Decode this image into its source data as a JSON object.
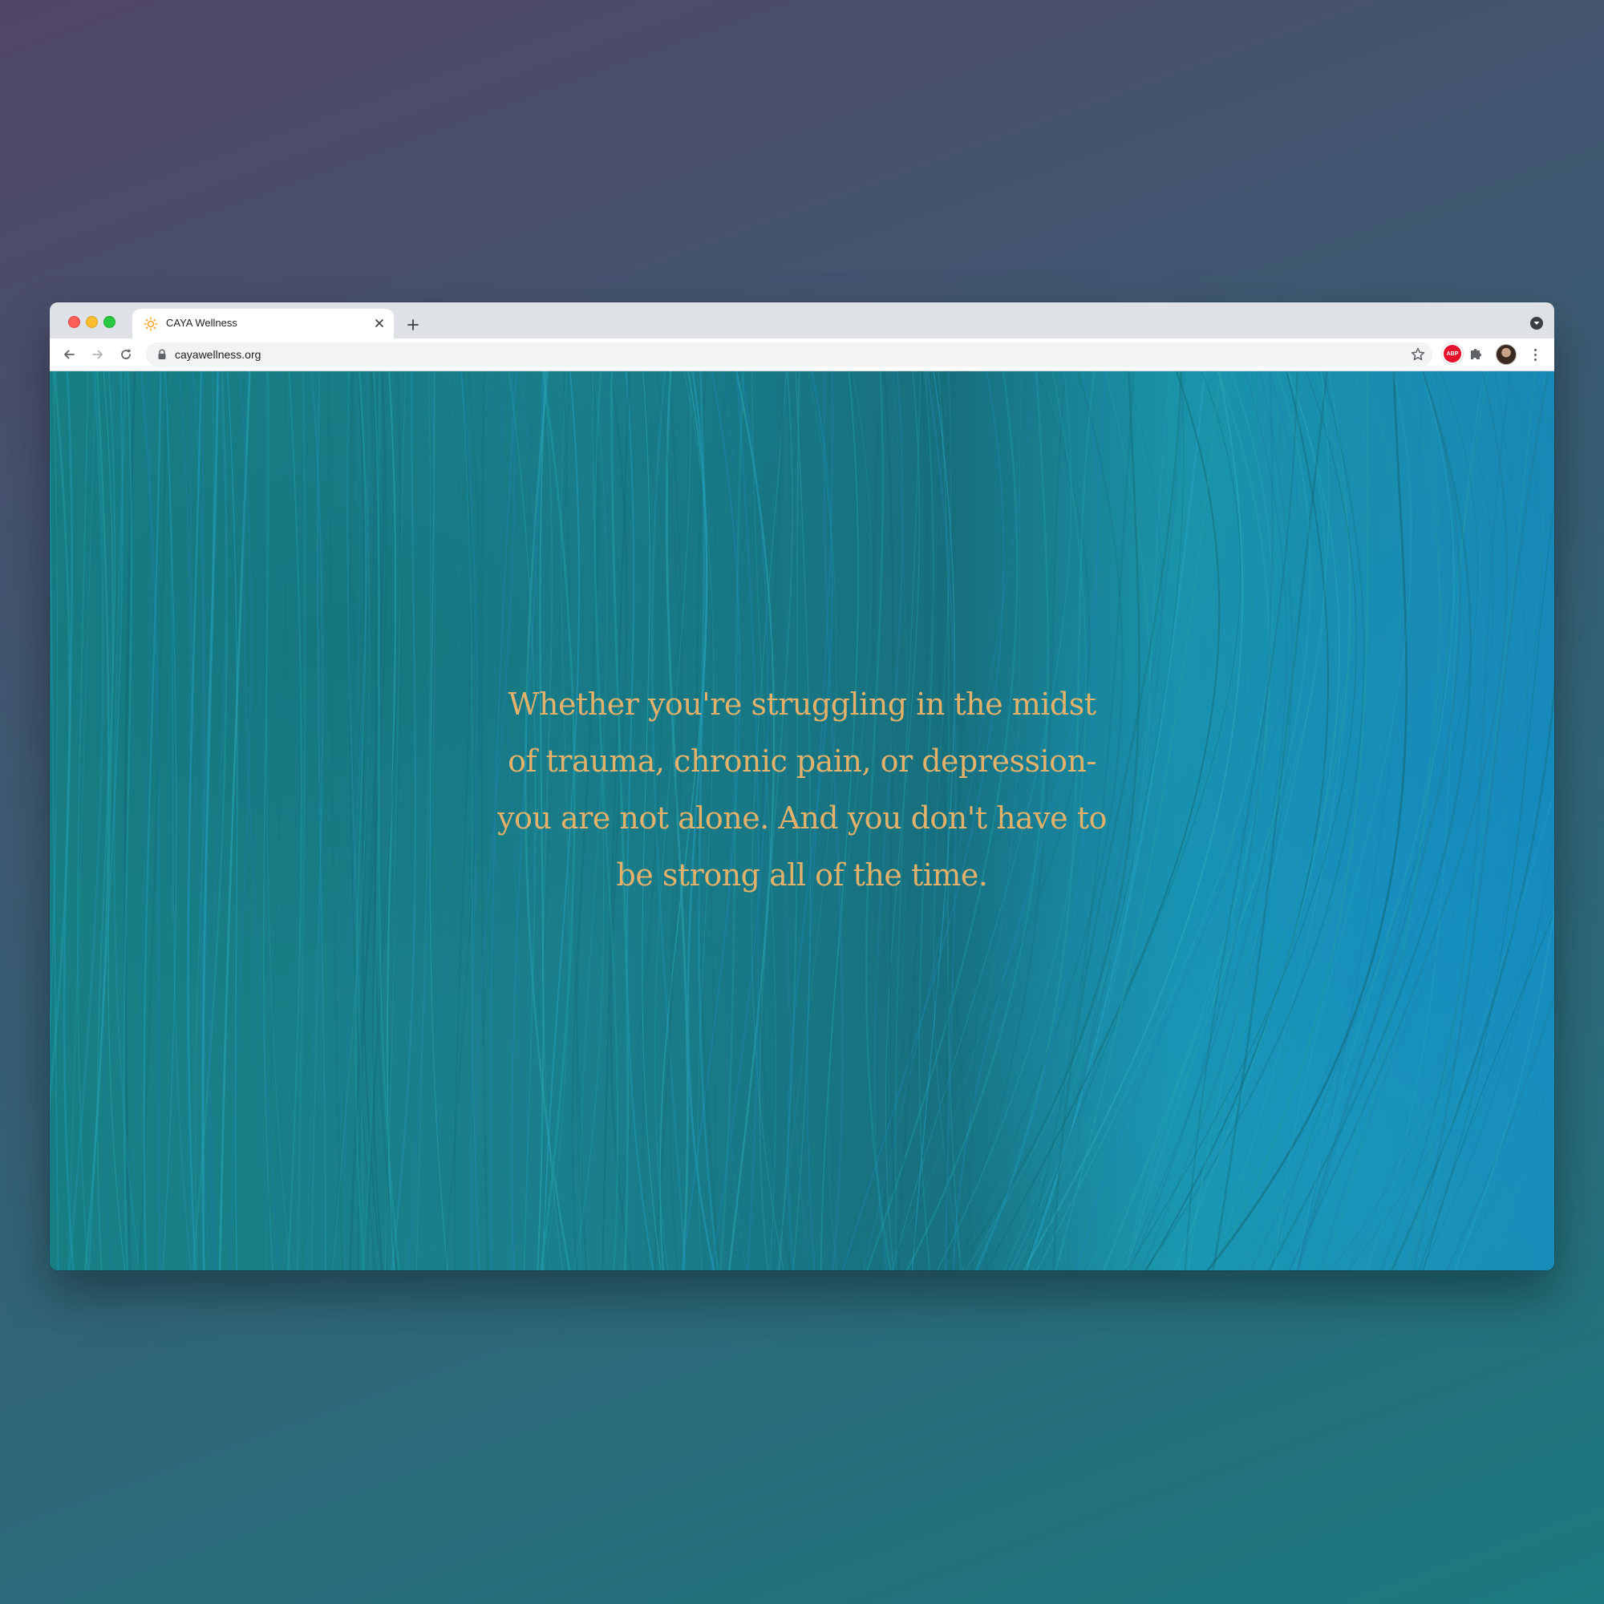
{
  "browser": {
    "tab": {
      "title": "CAYA Wellness",
      "icon": "sun-icon"
    },
    "address_bar": {
      "url": "cayawellness.org"
    },
    "extensions": {
      "adblock_label": "ABP"
    }
  },
  "page": {
    "quote": "Whether you're struggling in the midst of trauma, chronic pain, or depression- you are not alone. And you don't have to be strong all of the time."
  },
  "colors": {
    "quote_text": "#e3b169",
    "background_teal": "#177f84",
    "background_blue": "#1888b6"
  }
}
